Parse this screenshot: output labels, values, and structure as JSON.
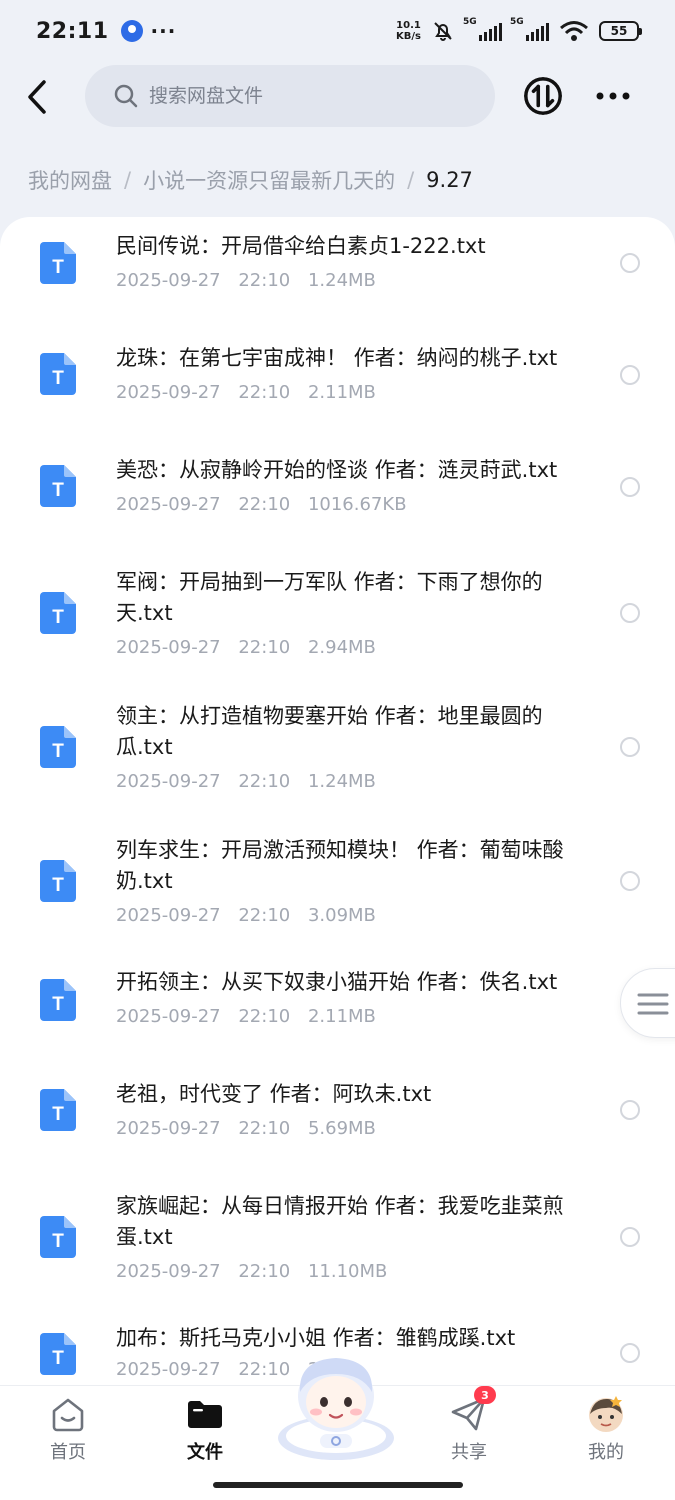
{
  "status_bar": {
    "time": "22:11",
    "dots": "···",
    "net_speed_value": "10.1",
    "net_speed_unit": "KB/s",
    "signal_1": "5G",
    "signal_2": "5G",
    "battery": "55"
  },
  "search": {
    "placeholder": "搜索网盘文件"
  },
  "breadcrumb": {
    "items": [
      "我的网盘",
      "小说一资源只留最新几天的"
    ],
    "separator": "/",
    "current": "9.27"
  },
  "files": [
    {
      "name": "民间传说：开局借伞给白素贞1-222.txt",
      "date": "2025-09-27",
      "time": "22:10",
      "size": "1.24MB"
    },
    {
      "name": "龙珠：在第七宇宙成神！ 作者：纳闷的桃子.txt",
      "date": "2025-09-27",
      "time": "22:10",
      "size": "2.11MB"
    },
    {
      "name": "美恐：从寂静岭开始的怪谈 作者：涟灵莳武.txt",
      "date": "2025-09-27",
      "time": "22:10",
      "size": "1016.67KB"
    },
    {
      "name": "军阀：开局抽到一万军队 作者：下雨了想你的天.txt",
      "date": "2025-09-27",
      "time": "22:10",
      "size": "2.94MB"
    },
    {
      "name": "领主：从打造植物要塞开始 作者：地里最圆的瓜.txt",
      "date": "2025-09-27",
      "time": "22:10",
      "size": "1.24MB"
    },
    {
      "name": "列车求生：开局激活预知模块！ 作者：葡萄味酸奶.txt",
      "date": "2025-09-27",
      "time": "22:10",
      "size": "3.09MB"
    },
    {
      "name": "开拓领主：从买下奴隶小猫开始 作者：佚名.txt",
      "date": "2025-09-27",
      "time": "22:10",
      "size": "2.11MB"
    },
    {
      "name": "老祖，时代变了 作者：阿玖未.txt",
      "date": "2025-09-27",
      "time": "22:10",
      "size": "5.69MB"
    },
    {
      "name": "家族崛起：从每日情报开始 作者：我爱吃韭菜煎蛋.txt",
      "date": "2025-09-27",
      "time": "22:10",
      "size": "11.10MB"
    },
    {
      "name": "加布：斯托马克小小姐 作者：雏鹤成蹊.txt",
      "date": "2025-09-27",
      "time": "22:10",
      "size": "2"
    }
  ],
  "file_icon_letter": "T",
  "colors": {
    "accent": "#2f7bf0",
    "file_icon": "#3d8bf5",
    "badge": "#ff3b4e"
  },
  "bottom_nav": {
    "home": "首页",
    "files": "文件",
    "share": "共享",
    "share_badge": "3",
    "mine": "我的"
  },
  "icons": [
    "back-icon",
    "search-icon",
    "transfer-icon",
    "more-icon",
    "txt-file-icon",
    "menu-lines-icon",
    "home-icon",
    "folder-icon",
    "mascot-icon",
    "paper-plane-icon",
    "avatar-icon"
  ]
}
